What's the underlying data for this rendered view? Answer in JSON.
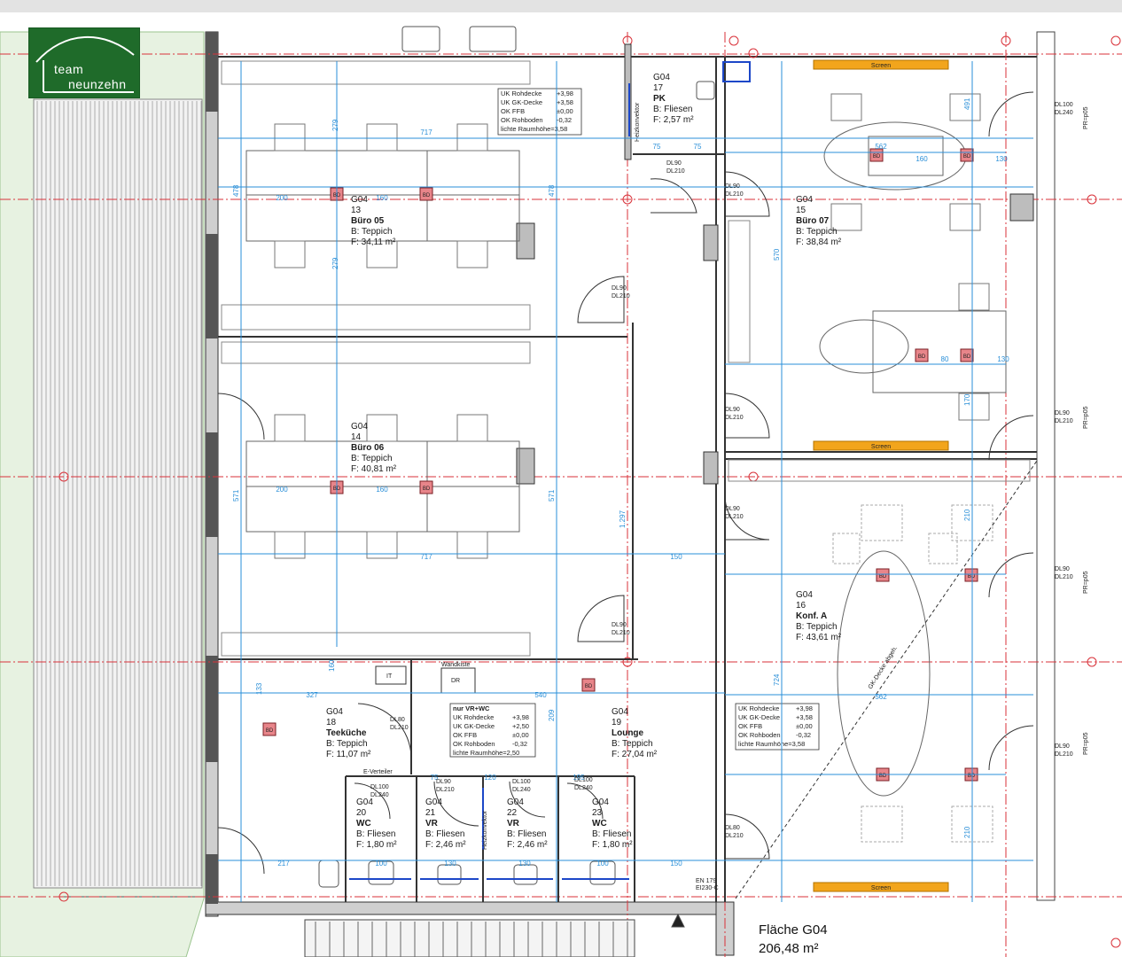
{
  "logo": {
    "line1": "team",
    "line2": "neunzehn"
  },
  "rooms": [
    {
      "level": "G04",
      "number": "13",
      "name": "Büro 05",
      "floor": "B: Teppich",
      "area": "F: 34,11 m²"
    },
    {
      "level": "G04",
      "number": "14",
      "name": "Büro 06",
      "floor": "B: Teppich",
      "area": "F: 40,81 m²"
    },
    {
      "level": "G04",
      "number": "15",
      "name": "Büro 07",
      "floor": "B: Teppich",
      "area": "F: 38,84 m²"
    },
    {
      "level": "G04",
      "number": "16",
      "name": "Konf. A",
      "floor": "B: Teppich",
      "area": "F: 43,61 m²"
    },
    {
      "level": "G04",
      "number": "17",
      "name": "PK",
      "floor": "B: Fliesen",
      "area": "F: 2,57 m²"
    },
    {
      "level": "G04",
      "number": "18",
      "name": "Teeküche",
      "floor": "B: Teppich",
      "area": "F: 11,07 m²"
    },
    {
      "level": "G04",
      "number": "19",
      "name": "Lounge",
      "floor": "B: Teppich",
      "area": "F: 27,04 m²"
    },
    {
      "level": "G04",
      "number": "20",
      "name": "WC",
      "floor": "B: Fliesen",
      "area": "F: 1,80 m²"
    },
    {
      "level": "G04",
      "number": "21",
      "name": "VR",
      "floor": "B: Fliesen",
      "area": "F: 2,46 m²"
    },
    {
      "level": "G04",
      "number": "22",
      "name": "VR",
      "floor": "B: Fliesen",
      "area": "F: 2,46 m²"
    },
    {
      "level": "G04",
      "number": "23",
      "name": "WC",
      "floor": "B: Fliesen",
      "area": "F: 1,80 m²"
    }
  ],
  "total": {
    "label": "Fläche G04",
    "area": "206,48 m²"
  },
  "screens": [
    "Screen",
    "Screen",
    "Screen"
  ],
  "info_box_1": [
    "UK Rohdecke",
    "+3,98",
    "UK GK-Decke",
    "+3,58",
    "OK FFB",
    "±0,00",
    "OK Rohboden",
    "-0,32",
    "lichte Raumhöhe=3,58"
  ],
  "info_box_2": [
    "nur VR+WC",
    "UK Rohdecke",
    "+3,98",
    "UK GK-Decke",
    "+2,50",
    "OK FFB",
    "±0,00",
    "OK Rohboden",
    "-0,32",
    "lichte Raumhöhe=2,50"
  ],
  "info_box_3": [
    "UK Rohdecke",
    "+3,98",
    "UK GK-Decke",
    "+3,58",
    "OK FFB",
    "±0,00",
    "OK Rohboden",
    "-0,32",
    "lichte Raumhöhe=3,58"
  ],
  "dims_h": [
    "717",
    "200",
    "160",
    "200",
    "160",
    "717",
    "150",
    "75",
    "75",
    "562",
    "160",
    "130",
    "327",
    "562",
    "80",
    "130",
    "150",
    "217",
    "100",
    "130",
    "130",
    "100",
    "120",
    "195",
    "540",
    "75"
  ],
  "dims_v": [
    "279",
    "478",
    "279",
    "571",
    "571",
    "478",
    "1.297",
    "570",
    "210",
    "724",
    "210",
    "170",
    "491",
    "209",
    "160",
    "133"
  ],
  "door_tags": [
    "DL90",
    "DL210",
    "DL90",
    "DL210",
    "DL90",
    "DL210",
    "DL90",
    "DL210",
    "DL90",
    "DL210",
    "DL90",
    "DL210",
    "DL80",
    "DL210",
    "DL80",
    "DL210",
    "DL90",
    "DL210",
    "DL100",
    "DL240",
    "DL100",
    "DL240",
    "DL100",
    "DL240",
    "DL100",
    "DL240",
    "DL90",
    "DL210",
    "DL90",
    "DL210",
    "DL90",
    "DL210"
  ],
  "misc": {
    "it": "IT",
    "dr": "DR",
    "wand": "Wandkiste",
    "bd": "BD",
    "ev": "E-Verteiler",
    "en": "EN 179",
    "ei": "EI230-C",
    "pr": "PR=p05",
    "heiz": "Heizkonvektor",
    "gk": "GK-Decke abgeh."
  }
}
